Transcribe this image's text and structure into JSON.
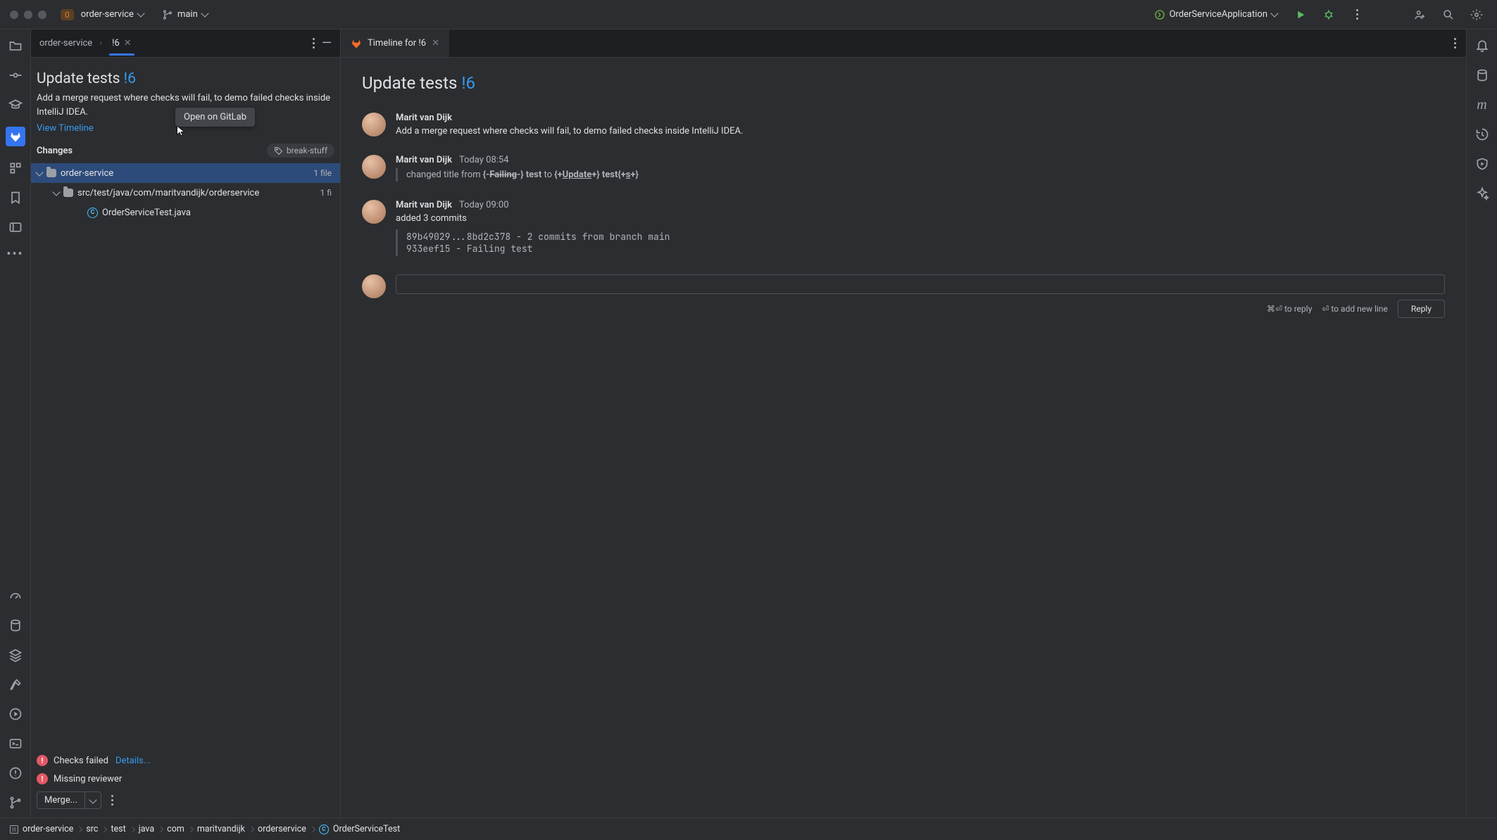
{
  "topbar": {
    "nav_count": "0",
    "project": "order-service",
    "branch": "main",
    "run_config": "OrderServiceApplication"
  },
  "left_panel": {
    "breadcrumb": "order-service",
    "tab": "!6",
    "title": "Update tests",
    "title_number": "!6",
    "tooltip": "Open on GitLab",
    "description": "Add a merge request where checks will fail, to demo failed checks inside IntelliJ IDEA.",
    "view_timeline": "View Timeline",
    "changes_label": "Changes",
    "tag": "break-stuff",
    "tree": {
      "root": "order-service",
      "root_count": "1 file",
      "pkg": "src/test/java/com/maritvandijk/orderservice",
      "pkg_count": "1 fi",
      "file": "OrderServiceTest.java"
    },
    "footer": {
      "checks_failed": "Checks failed",
      "details": "Details...",
      "missing_reviewer": "Missing reviewer",
      "merge": "Merge..."
    }
  },
  "main": {
    "tab_label": "Timeline for !6",
    "title": "Update tests",
    "title_number": "!6",
    "items": [
      {
        "author": "Marit van Dijk",
        "time": "",
        "body_plain": "Add a merge request where checks will fail, to demo failed checks inside IntelliJ IDEA."
      },
      {
        "author": "Marit van Dijk",
        "time": "Today 08:54",
        "title_change_prefix": "changed title from",
        "from": "Failing",
        "from_suffix": " test",
        "to_prefix": "Update",
        "to_suffix": " test",
        "plus": "s"
      },
      {
        "author": "Marit van Dijk",
        "time": "Today 09:00",
        "added": "added 3 commits",
        "commits": [
          {
            "hash": "89b49029...8bd2c378",
            "msg": "2 commits from branch",
            "branch": "main"
          },
          {
            "hash": "933eef15",
            "msg": "Failing test"
          }
        ]
      }
    ],
    "reply_hints": {
      "cmd": "⌘⏎",
      "cmd_text": "to reply",
      "nl": "⏎",
      "nl_text": "to add new line"
    },
    "reply_btn": "Reply"
  },
  "statusbar": {
    "crumbs": [
      "order-service",
      "src",
      "test",
      "java",
      "com",
      "maritvandijk",
      "orderservice"
    ],
    "file": "OrderServiceTest"
  }
}
